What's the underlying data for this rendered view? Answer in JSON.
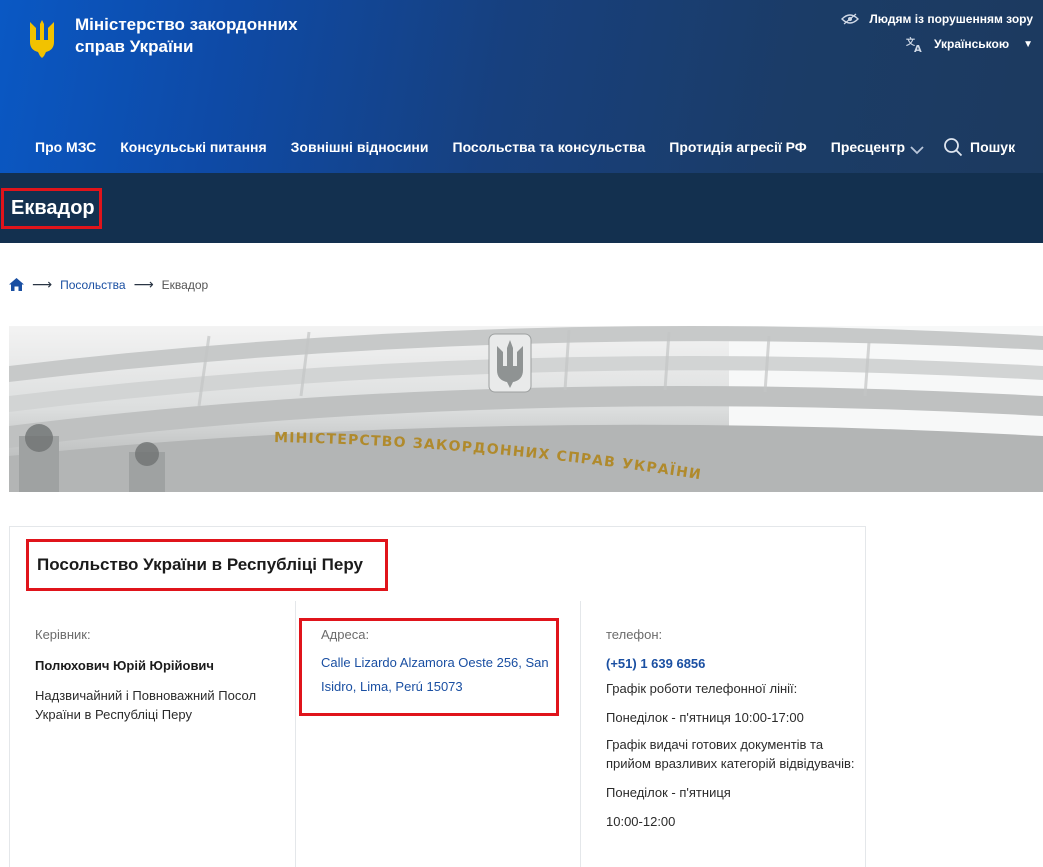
{
  "header": {
    "ministry_name": "Міністерство закордонних справ України",
    "accessibility_label": "Людям із порушенням зору",
    "language_label": "Українською",
    "search_label": "Пошук"
  },
  "nav": {
    "items": [
      {
        "label": "Про МЗС"
      },
      {
        "label": "Консульські питання"
      },
      {
        "label": "Зовнішні відносини"
      },
      {
        "label": "Посольства та консульства"
      },
      {
        "label": "Протидія агресії РФ"
      },
      {
        "label": "Пресцентр"
      }
    ]
  },
  "page": {
    "title": "Еквадор"
  },
  "breadcrumb": {
    "items": [
      "Посольства",
      "Еквадор"
    ]
  },
  "banner": {
    "caption": "МІНІСТЕРСТВО ЗАКОРДОННИХ СПРАВ УКРАЇНИ"
  },
  "embassy": {
    "title": "Посольство України в Республіці Перу",
    "head_label": "Керівник:",
    "head_name": "Полюхович Юрій Юрійович",
    "head_position": "Надзвичайний і Повноважний Посол України в Республіці Перу",
    "address_label": "Адреса:",
    "address": "Calle Lizardo Alzamora Oeste 256, San Isidro, Lima, Perú 15073",
    "phone_label": "телефон:",
    "phone": "(+51) 1 639 6856",
    "hotline_schedule_label": "Графік роботи телефонної лінії:",
    "hotline_hours": "Понеділок - п'ятниця 10:00-17:00",
    "docs_schedule_label": "Графік видачі готових документів та прийом вразливих категорій відвідувачів:",
    "docs_days": "Понеділок - п'ятниця",
    "docs_hours": "10:00-12:00"
  },
  "colors": {
    "accent": "#1a4fa2",
    "title_band": "#13304f",
    "highlight": "#e0141b"
  }
}
